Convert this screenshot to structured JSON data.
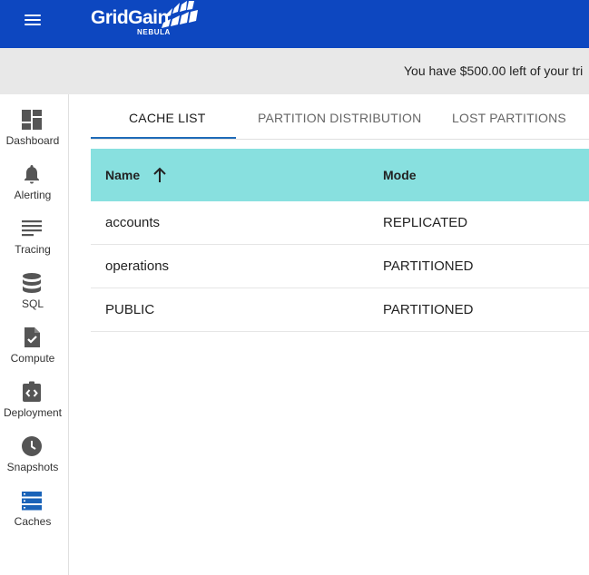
{
  "header": {
    "logo_text": "GridGain",
    "logo_subtext": "NEBULA",
    "menu_icon": "hamburger-menu-icon",
    "brand_color": "#0d47c0"
  },
  "banner": {
    "text": "You have $500.00 left of your tri"
  },
  "sidebar": {
    "items": [
      {
        "label": "Dashboard",
        "icon": "dashboard-icon"
      },
      {
        "label": "Alerting",
        "icon": "bell-icon"
      },
      {
        "label": "Tracing",
        "icon": "tracing-icon"
      },
      {
        "label": "SQL",
        "icon": "database-icon"
      },
      {
        "label": "Compute",
        "icon": "compute-icon"
      },
      {
        "label": "Deployment",
        "icon": "deployment-icon"
      },
      {
        "label": "Snapshots",
        "icon": "clock-icon"
      },
      {
        "label": "Caches",
        "icon": "caches-icon"
      }
    ],
    "active_item": "Caches"
  },
  "tabs": [
    {
      "label": "CACHE LIST",
      "active": true
    },
    {
      "label": "PARTITION DISTRIBUTION",
      "active": false
    },
    {
      "label": "LOST PARTITIONS",
      "active": false
    }
  ],
  "table": {
    "header_color": "#88e0df",
    "columns": [
      {
        "label": "Name",
        "sort": "ascending"
      },
      {
        "label": "Mode"
      }
    ],
    "rows": [
      [
        "accounts",
        "REPLICATED"
      ],
      [
        "operations",
        "PARTITIONED"
      ],
      [
        "PUBLIC",
        "PARTITIONED"
      ]
    ]
  }
}
